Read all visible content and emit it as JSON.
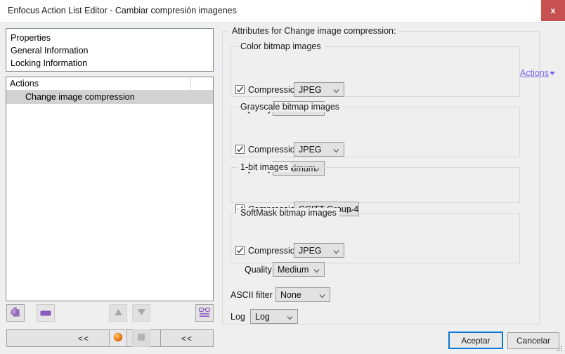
{
  "window": {
    "title": "Enfocus Action List Editor - Cambiar compresión imagenes",
    "close_label": "x"
  },
  "left_panel": {
    "properties": [
      {
        "label": "Properties"
      },
      {
        "label": "General Information"
      },
      {
        "label": "Locking Information"
      }
    ],
    "actions_list": {
      "header": "Actions",
      "rows": [
        {
          "label": "Change image compression",
          "selected": true
        }
      ]
    },
    "toolbar": {
      "add_icon": "add-pages-icon",
      "remove_icon": "remove-icon",
      "move_up_icon": "triangle-up-icon",
      "move_down_icon": "triangle-down-icon",
      "preview_icon": "glasses-icon",
      "enabled_icon": "orange-sphere-icon",
      "disabled_icon": "gray-square-icon",
      "collapse_left_label": "<<",
      "collapse_right_label": "<<"
    }
  },
  "attributes": {
    "title": "Attributes for Change image compression:",
    "actions_link": "Actions",
    "groups": [
      {
        "legend": "Color bitmap images",
        "compression_label": "Compression",
        "compression_checked": true,
        "compression_value": "JPEG",
        "quality_label": "Quality",
        "quality_value": "Maximum"
      },
      {
        "legend": "Grayscale bitmap images",
        "compression_label": "Compression",
        "compression_checked": true,
        "compression_value": "JPEG",
        "quality_label": "Quality",
        "quality_value": "Maximum"
      },
      {
        "legend": "1-bit images",
        "compression_label": "Compression",
        "compression_checked": true,
        "compression_value": "CCITT Group 4"
      },
      {
        "legend": "SoftMask bitmap images",
        "compression_label": "Compression",
        "compression_checked": true,
        "compression_value": "JPEG",
        "quality_label": "Quality",
        "quality_value": "Medium"
      }
    ],
    "ascii_filter_label": "ASCII filter",
    "ascii_filter_value": "None",
    "log_label": "Log",
    "log_value": "Log"
  },
  "footer": {
    "accept_label": "Aceptar",
    "cancel_label": "Cancelar"
  },
  "colors": {
    "accent_link": "#7b68ee",
    "close_button": "#c75050",
    "focus_border": "#0a7ad6",
    "selection": "#d2d2d2"
  }
}
